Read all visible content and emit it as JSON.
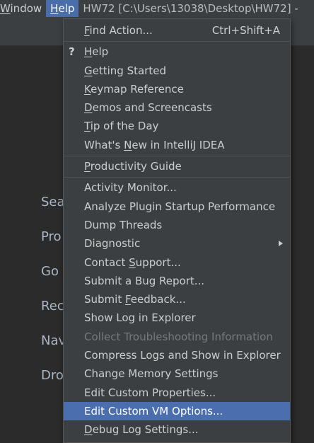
{
  "menubar": {
    "window": {
      "pre": "",
      "ul": "W",
      "post": "indow"
    },
    "help": {
      "pre": "",
      "ul": "H",
      "post": "elp"
    },
    "title": "HW72 [C:\\Users\\13038\\Desktop\\HW72] -"
  },
  "background": {
    "items": [
      "Sea",
      "Pro",
      "Go",
      "Rec",
      "Nav",
      "Dro"
    ]
  },
  "menu": {
    "find_action": {
      "pre": "",
      "ul": "F",
      "post": "ind Action...",
      "shortcut": "Ctrl+Shift+A"
    },
    "help_icon": "?",
    "help": {
      "pre": "",
      "ul": "H",
      "post": "elp"
    },
    "getting_started": {
      "pre": "",
      "ul": "G",
      "post": "etting Started"
    },
    "keymap_reference": {
      "pre": "",
      "ul": "K",
      "post": "eymap Reference"
    },
    "demos": {
      "pre": "",
      "ul": "D",
      "post": "emos and Screencasts"
    },
    "tip_of_day": {
      "pre": "",
      "ul": "T",
      "post": "ip of the Day"
    },
    "whats_new": {
      "pre": "What's ",
      "ul": "N",
      "post": "ew in IntelliJ IDEA"
    },
    "productivity_guide": {
      "pre": "",
      "ul": "P",
      "post": "roductivity Guide"
    },
    "activity_monitor": "Activity Monitor...",
    "analyze_plugin": "Analyze Plugin Startup Performance",
    "dump_threads": "Dump Threads",
    "diagnostic": "Diagnostic",
    "contact_support": {
      "pre": "Contact ",
      "ul": "S",
      "post": "upport..."
    },
    "submit_bug": "Submit a Bug Report...",
    "submit_feedback": {
      "pre": "Submit ",
      "ul": "F",
      "post": "eedback..."
    },
    "show_log": "Show Log in Explorer",
    "collect_troubleshooting": "Collect Troubleshooting Information",
    "compress_logs": "Compress Logs and Show in Explorer",
    "change_memory": "Change Memory Settings",
    "edit_properties": "Edit Custom Properties...",
    "edit_vm": "Edit Custom VM Options...",
    "debug_log": {
      "pre": "",
      "ul": "D",
      "post": "ebug Log Settings..."
    }
  },
  "colors": {
    "selected": "#4b6eaf",
    "menubar_active": "#4a6ea9",
    "menu_bg": "#3c3f41",
    "disabled": "#787878"
  }
}
